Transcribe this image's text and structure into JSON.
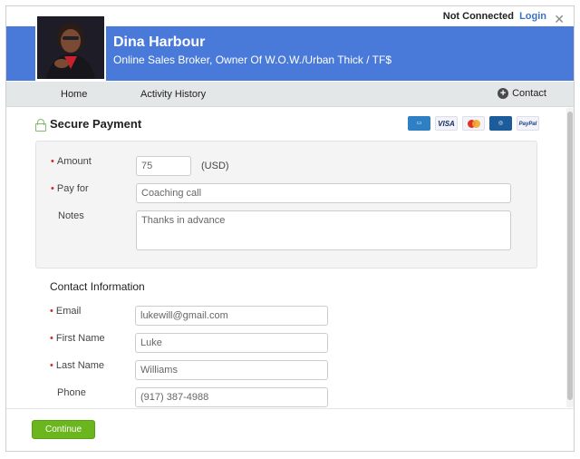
{
  "status": {
    "connection": "Not Connected",
    "login": "Login"
  },
  "profile": {
    "name": "Dina Harbour",
    "title": "Online Sales Broker, Owner Of W.O.W./Urban Thick / TF$"
  },
  "nav": {
    "home": "Home",
    "activity": "Activity History",
    "contact": "Contact"
  },
  "payment": {
    "title": "Secure Payment",
    "cards": [
      "amex-card-icon",
      "visa-card-icon",
      "mastercard-icon",
      "diners-card-icon",
      "paypal-icon"
    ],
    "card_labels": {
      "visa": "VISA",
      "paypal": "PayPal"
    },
    "amount_label": "Amount",
    "amount_value": "75",
    "currency": "(USD)",
    "payfor_label": "Pay for",
    "payfor_value": "Coaching call",
    "notes_label": "Notes",
    "notes_value": "Thanks in advance"
  },
  "contact": {
    "title": "Contact Information",
    "email_label": "Email",
    "email_value": "lukewill@gmail.com",
    "first_label": "First Name",
    "first_value": "Luke",
    "last_label": "Last Name",
    "last_value": "Williams",
    "phone_label": "Phone",
    "phone_value": "(917) 387-4988"
  },
  "footer": {
    "continue": "Continue"
  },
  "colors": {
    "header": "#4a7ad9",
    "accent_link": "#3b72c8",
    "button": "#6bb61e",
    "required": "#d02a2a"
  }
}
